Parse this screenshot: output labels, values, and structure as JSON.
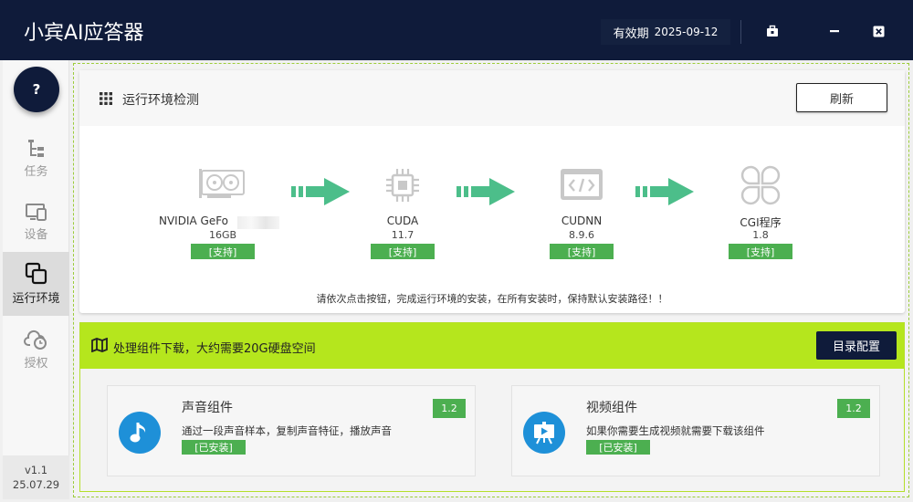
{
  "app": {
    "title": "小宾AI应答器",
    "expiry_label": "有效期",
    "expiry_date": "2025-09-12"
  },
  "sidebar": {
    "help_label": "?",
    "items": [
      {
        "label": "任务",
        "icon": "task-tree-icon",
        "active": false
      },
      {
        "label": "设备",
        "icon": "device-icon",
        "active": false
      },
      {
        "label": "运行环境",
        "icon": "runtime-env-icon",
        "active": true
      },
      {
        "label": "授权",
        "icon": "cloud-clock-icon",
        "active": false
      }
    ],
    "version": "v1.1",
    "build_date": "25.07.29"
  },
  "env": {
    "title": "运行环境检测",
    "refresh_label": "刷新",
    "stages": [
      {
        "name": "NVIDIA GeFo",
        "version": "16GB",
        "status": "[支持]",
        "icon": "gpu-icon"
      },
      {
        "name": "CUDA",
        "version": "11.7",
        "status": "[支持]",
        "icon": "chip-icon"
      },
      {
        "name": "CUDNN",
        "version": "8.9.6",
        "status": "[支持]",
        "icon": "code-window-icon"
      },
      {
        "name": "CGI程序",
        "version": "1.8",
        "status": "[支持]",
        "icon": "clover-icon"
      }
    ],
    "hint": "请依次点击按钮，完成运行环境的安装，在所有安装时，保持默认安装路径！！"
  },
  "download": {
    "title": "处理组件下载，大约需要20G硬盘空间",
    "dir_button": "目录配置",
    "components": [
      {
        "name": "声音组件",
        "desc": "通过一段声音样本，复制声音特征，播放声音",
        "status": "[已安装]",
        "version": "1.2",
        "icon": "music-note-icon"
      },
      {
        "name": "视频组件",
        "desc": "如果你需要生成视频就需要下载该组件",
        "status": "[已安装]",
        "version": "1.2",
        "icon": "video-presentation-icon"
      }
    ]
  },
  "colors": {
    "titlebar": "#0f1b3a",
    "accent_green": "#4caf50",
    "lime_header": "#b5e61d",
    "arrow_green": "#4cbe8a",
    "component_blue": "#1e90d8"
  }
}
